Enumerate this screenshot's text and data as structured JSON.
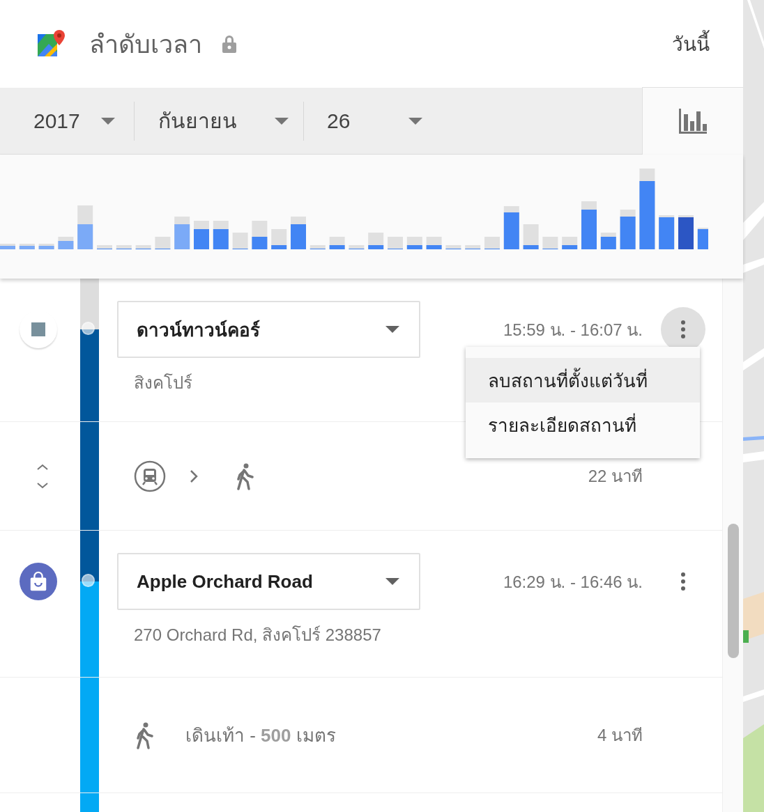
{
  "header": {
    "title": "ลำดับเวลา",
    "today_link": "วันนี้"
  },
  "date_selectors": [
    {
      "value": "2017"
    },
    {
      "value": "กันยายน"
    },
    {
      "value": "26"
    }
  ],
  "chart_toggle": {
    "selected": true
  },
  "timeline": [
    {
      "kind": "place",
      "name": "ดาวน์ทาวน์คอร์",
      "address": "สิงคโปร์",
      "time": "15:59 น. - 16:07 น.",
      "color": "#01579b",
      "menu_open": true
    },
    {
      "kind": "transit",
      "modes": [
        {
          "kind": "train"
        },
        {
          "kind": "walk"
        }
      ],
      "duration": "22 นาที"
    },
    {
      "kind": "shopping",
      "name": "Apple Orchard Road",
      "address": "270 Orchard Rd, สิงคโปร์ 238857",
      "time": "16:29 น. - 16:46 น.",
      "color": "#03a9f4",
      "menu_open": false
    },
    {
      "kind": "walk",
      "text": "เดินเท้า - **500** เมตร",
      "duration": "4 นาที"
    }
  ],
  "menu": {
    "items": [
      {
        "label": "ลบสถานที่ตั้งแต่วันที่",
        "highlighted": true
      },
      {
        "label": "รายละเอียดสถานที่",
        "highlighted": false
      }
    ]
  }
}
